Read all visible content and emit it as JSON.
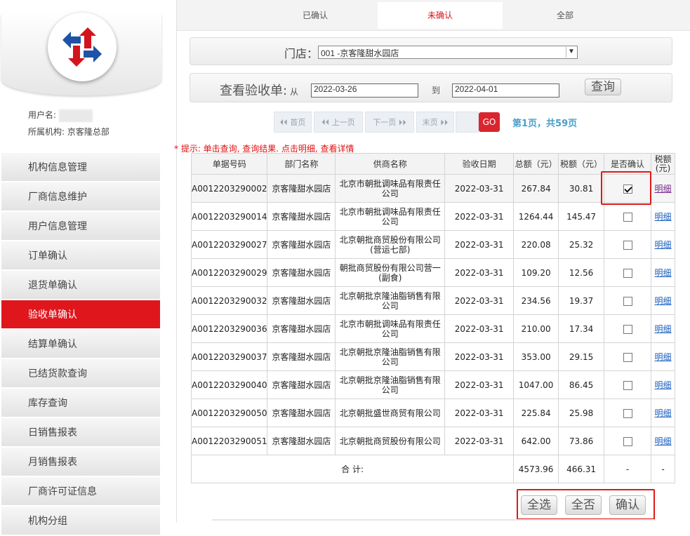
{
  "sidebar": {
    "user_label": "用户名:",
    "org_label": "所属机构:",
    "org_value": "京客隆总部",
    "menu": [
      {
        "label": "机构信息管理"
      },
      {
        "label": "厂商信息维护"
      },
      {
        "label": "用户信息管理"
      },
      {
        "label": "订单确认"
      },
      {
        "label": "退货单确认"
      },
      {
        "label": "验收单确认",
        "active": true
      },
      {
        "label": "结算单确认"
      },
      {
        "label": "已结货款查询"
      },
      {
        "label": "库存查询"
      },
      {
        "label": "日销售报表"
      },
      {
        "label": "月销售报表"
      },
      {
        "label": "厂商许可证信息"
      },
      {
        "label": "机构分组"
      }
    ]
  },
  "tabs": [
    {
      "label": "已确认"
    },
    {
      "label": "未确认",
      "active": true
    },
    {
      "label": "全部"
    }
  ],
  "store": {
    "label": "门店：",
    "value": "001 -京客隆甜水园店"
  },
  "query": {
    "title": "查看验收单:",
    "from_label": "从",
    "from": "2022-03-26",
    "to_label": "到",
    "to": "2022-04-01",
    "button": "查询"
  },
  "pager": {
    "first": "⏴⏴ 首页",
    "prev": "⏴⏴ 上一页",
    "next": "下一页 ⏵⏵",
    "last": "末页 ⏵⏵",
    "page_input": "",
    "go": "GO",
    "info": "第1页，共59页"
  },
  "hint": "* 提示: 单击查询, 查询结果. 点击明细, 查看详情",
  "table": {
    "headers": [
      "单据号码",
      "部门名称",
      "供商名称",
      "验收日期",
      "总额（元）",
      "税额（元）",
      "是否确认",
      "税额(元)"
    ],
    "rows": [
      {
        "id": "A0012203290002",
        "dept": "京客隆甜水园店",
        "vendor": "北京市朝批调味品有限责任公司",
        "date": "2022-03-31",
        "total": "267.84",
        "tax": "30.81",
        "checked": true,
        "link": "明细"
      },
      {
        "id": "A0012203290014",
        "dept": "京客隆甜水园店",
        "vendor": "北京市朝批调味品有限责任公司",
        "date": "2022-03-31",
        "total": "1264.44",
        "tax": "145.47",
        "checked": false,
        "link": "明细"
      },
      {
        "id": "A0012203290027",
        "dept": "京客隆甜水园店",
        "vendor": "北京朝批商贸股份有限公司(营运七部)",
        "date": "2022-03-31",
        "total": "220.08",
        "tax": "25.32",
        "checked": false,
        "link": "明细"
      },
      {
        "id": "A0012203290029",
        "dept": "京客隆甜水园店",
        "vendor": "朝批商贸股份有限公司营一(副食)",
        "date": "2022-03-31",
        "total": "109.20",
        "tax": "12.56",
        "checked": false,
        "link": "明细"
      },
      {
        "id": "A0012203290032",
        "dept": "京客隆甜水园店",
        "vendor": "北京朝批京隆油脂销售有限公司",
        "date": "2022-03-31",
        "total": "234.56",
        "tax": "19.37",
        "checked": false,
        "link": "明细"
      },
      {
        "id": "A0012203290036",
        "dept": "京客隆甜水园店",
        "vendor": "北京市朝批调味品有限责任公司",
        "date": "2022-03-31",
        "total": "210.00",
        "tax": "17.34",
        "checked": false,
        "link": "明细"
      },
      {
        "id": "A0012203290037",
        "dept": "京客隆甜水园店",
        "vendor": "北京朝批京隆油脂销售有限公司",
        "date": "2022-03-31",
        "total": "353.00",
        "tax": "29.15",
        "checked": false,
        "link": "明细"
      },
      {
        "id": "A0012203290040",
        "dept": "京客隆甜水园店",
        "vendor": "北京朝批京隆油脂销售有限公司",
        "date": "2022-03-31",
        "total": "1047.00",
        "tax": "86.45",
        "checked": false,
        "link": "明细"
      },
      {
        "id": "A0012203290050",
        "dept": "京客隆甜水园店",
        "vendor": "北京朝批盛世商贸有限公司",
        "date": "2022-03-31",
        "total": "225.84",
        "tax": "25.98",
        "checked": false,
        "link": "明细"
      },
      {
        "id": "A0012203290051",
        "dept": "京客隆甜水园店",
        "vendor": "北京朝批商贸股份有限公司",
        "date": "2022-03-31",
        "total": "642.00",
        "tax": "73.86",
        "checked": false,
        "link": "明细"
      }
    ],
    "footer": {
      "label": "合 计:",
      "total": "4573.96",
      "tax": "466.31",
      "confirm": "-",
      "link": "-"
    }
  },
  "actions": {
    "select_all": "全选",
    "select_none": "全否",
    "confirm": "确认"
  },
  "colors": {
    "accent": "#e0161d",
    "link": "#1a5fbf",
    "pager_info": "#4a9fc9"
  },
  "icons": {
    "logo": "logo-arrows-icon",
    "checkmark": "checkmark-icon"
  }
}
